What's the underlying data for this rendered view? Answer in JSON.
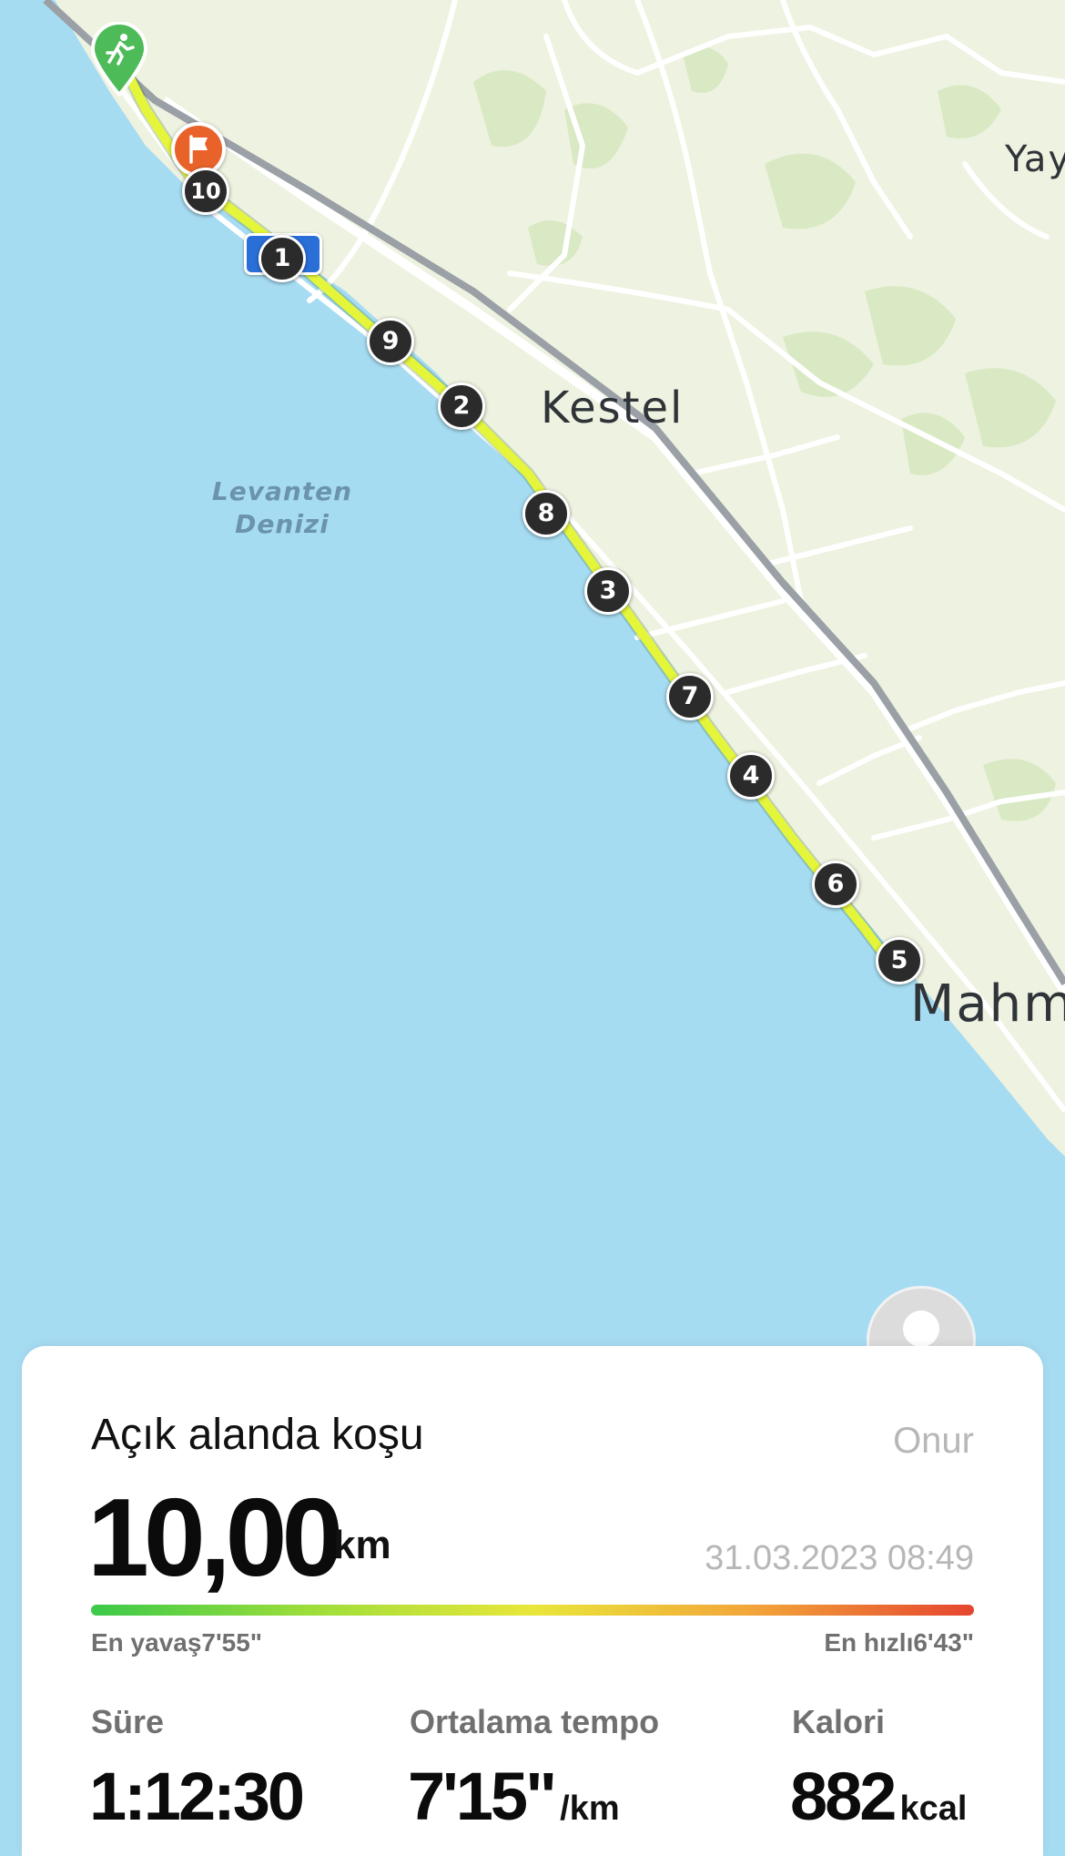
{
  "map": {
    "labels": {
      "city_kestel": "Kestel",
      "city_mahmutlar": "Mahm",
      "city_yay": "Yay",
      "sea_line1": "Levanten",
      "sea_line2": "Denizi"
    },
    "km_markers": [
      "1",
      "2",
      "3",
      "4",
      "5",
      "6",
      "7",
      "8",
      "9",
      "10"
    ],
    "start_icon": "running-person-icon",
    "end_icon": "finish-flag-icon",
    "route_color": "#e4f53a"
  },
  "card": {
    "activity_title": "Açık alanda koşu",
    "user_name": "Onur",
    "avatar_icon": "default-avatar-icon",
    "distance_value": "10,00",
    "distance_unit": "km",
    "date_time": "31.03.2023 08:49",
    "pace_bar": {
      "slow_label": "En yavaş7'55\"",
      "fast_label": "En hızlı6'43\""
    },
    "stats": {
      "duration_label": "Süre",
      "duration_value": "1:12:30",
      "pace_label": "Ortalama tempo",
      "pace_value": "7'15\"",
      "pace_unit": "/km",
      "calories_label": "Kalori",
      "calories_value": "882",
      "calories_unit": "kcal"
    }
  },
  "colors": {
    "sea": "#a6dcf2",
    "land": "#eef2e0",
    "park": "#d4e8bd",
    "road": "#ffffff",
    "railway": "#9aa0a6",
    "start_pin": "#4cbb58",
    "end_pin": "#e8622a"
  }
}
